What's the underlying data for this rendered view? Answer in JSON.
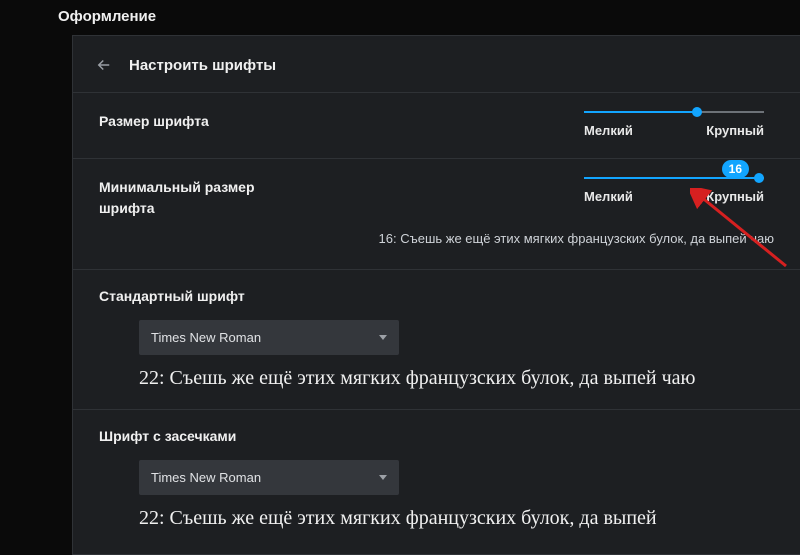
{
  "page_title": "Оформление",
  "header": {
    "title": "Настроить шрифты"
  },
  "font_size": {
    "label": "Размер шрифта",
    "min_label": "Мелкий",
    "max_label": "Крупный",
    "value_pct": 63
  },
  "min_font_size": {
    "label": "Минимальный размер шрифта",
    "min_label": "Мелкий",
    "max_label": "Крупный",
    "value_pct": 97,
    "badge": "16",
    "sample": "16: Съешь же ещё этих мягких французских булок, да выпей чаю"
  },
  "standard_font": {
    "heading": "Стандартный шрифт",
    "selected": "Times New Roman",
    "sample": "22: Съешь же ещё этих мягких французских булок, да выпей чаю"
  },
  "serif_font": {
    "heading": "Шрифт с засечками",
    "selected": "Times New Roman",
    "sample": "22: Съешь же ещё этих мягких французских булок, да выпей"
  }
}
